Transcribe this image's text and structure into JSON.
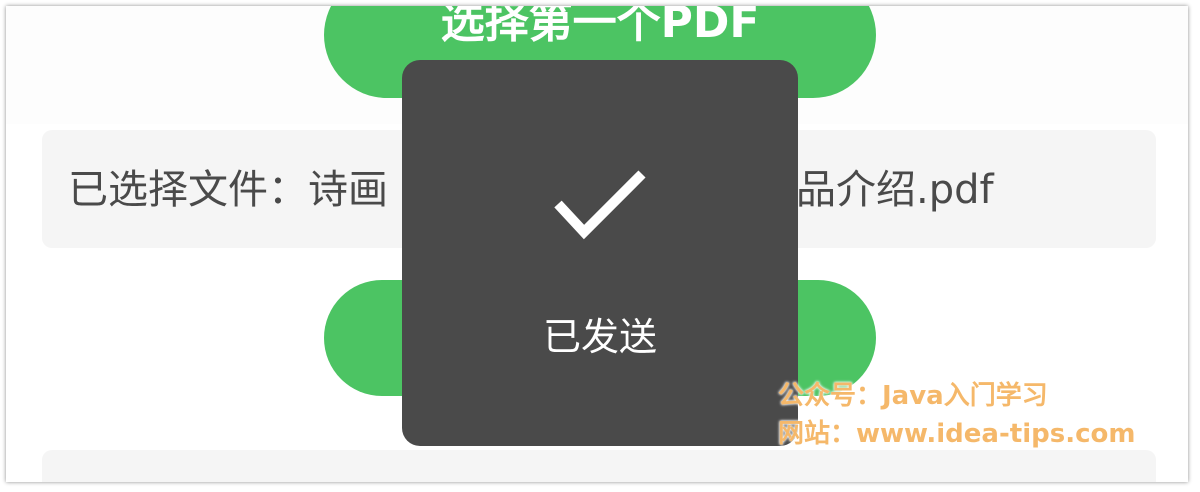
{
  "buttons": {
    "select_first_pdf": "选择第一个PDF",
    "second_button": ""
  },
  "file_selection": {
    "text_start": "已选择文件：诗画",
    "text_end": "品介绍.pdf"
  },
  "toast": {
    "icon": "checkmark-icon",
    "label": "已发送"
  },
  "watermark": {
    "line1": "公众号：Java入门学习",
    "line2": "网站：www.idea-tips.com"
  },
  "colors": {
    "accent_green": "#4cc463",
    "toast_background": "#4a4a4a",
    "watermark_orange": "#f5b86a",
    "file_box_background": "#f5f5f5"
  }
}
